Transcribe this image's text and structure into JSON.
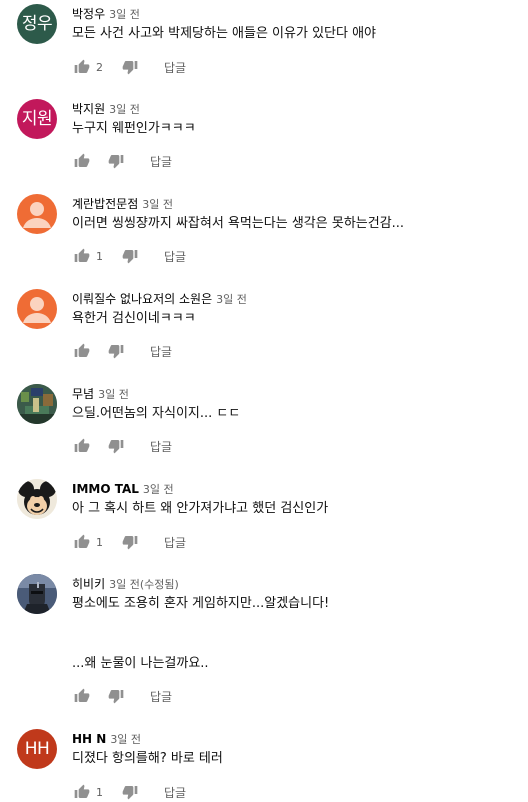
{
  "comments": [
    {
      "author": "박정우",
      "time": "3일 전",
      "text": "모든 사건 사고와 박제당하는 애들은 이유가 있단다 애야",
      "likes": "2",
      "reply": "답글",
      "avatar_text": "정우",
      "avatar_color": "#2d5a4a"
    },
    {
      "author": "박지원",
      "time": "3일 전",
      "text": "누구지 웨펀인가ㅋㅋㅋ",
      "likes": "",
      "reply": "답글",
      "avatar_text": "지원",
      "avatar_color": "#c2185b"
    },
    {
      "author": "계란밥전문점",
      "time": "3일 전",
      "text": "이러면 씽씽쟝까지 싸잡혀서 욕먹는다는 생각은 못하는건감...",
      "likes": "1",
      "reply": "답글",
      "avatar_color": "#ef6c35"
    },
    {
      "author": "이뤄질수 없나요저의 소원은",
      "time": "3일 전",
      "text": "욕한거 검신이네ㅋㅋㅋ",
      "likes": "",
      "reply": "답글",
      "avatar_color": "#ef6c35"
    },
    {
      "author": "무념",
      "time": "3일 전",
      "text": "으딜.어떤놈의 자식이지... ㄷㄷ",
      "likes": "",
      "reply": "답글"
    },
    {
      "author": "IMMO TAL",
      "time": "3일 전",
      "text": "아 그 혹시 하트 왜 안가져가냐고 했던 검신인가",
      "likes": "1",
      "reply": "답글"
    },
    {
      "author": "히비키",
      "time": "3일 전(수정됨)",
      "text": "평소에도 조용히 혼자 게임하지만...알겠습니다!",
      "text2": "...왜 눈물이 나는걸까요..",
      "likes": "",
      "reply": "답글"
    },
    {
      "author": "HH N",
      "time": "3일 전",
      "text": "디졌다 항의를해? 바로 테러",
      "likes": "1",
      "reply": "답글",
      "avatar_text": "HH",
      "avatar_color": "#c0391b"
    }
  ],
  "icons": {
    "like": "thumbs-up-icon",
    "dislike": "thumbs-down-icon"
  }
}
